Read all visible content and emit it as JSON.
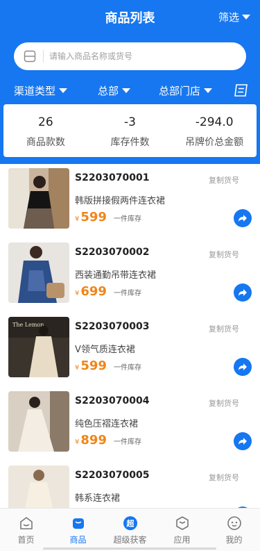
{
  "header": {
    "title": "商品列表",
    "filter_label": "筛选"
  },
  "search": {
    "placeholder": "请输入商品名称或货号"
  },
  "dropdowns": [
    {
      "label": "渠道类型"
    },
    {
      "label": "总部"
    },
    {
      "label": "总部门店"
    }
  ],
  "stats": [
    {
      "value": "26",
      "label": "商品款数"
    },
    {
      "value": "-3",
      "label": "库存件数"
    },
    {
      "value": "-294.0",
      "label": "吊牌价总金额"
    }
  ],
  "products": [
    {
      "code": "S2203070001",
      "name": "韩版拼接假两件连衣裙",
      "currency": "¥",
      "price": "599",
      "stock": "一件库存",
      "copy": "复制货号"
    },
    {
      "code": "S2203070002",
      "name": "西装通勤吊带连衣裙",
      "currency": "¥",
      "price": "699",
      "stock": "一件库存",
      "copy": "复制货号"
    },
    {
      "code": "S2203070003",
      "name": "V领气质连衣裙",
      "currency": "¥",
      "price": "599",
      "stock": "一件库存",
      "copy": "复制货号"
    },
    {
      "code": "S2203070004",
      "name": "纯色压褶连衣裙",
      "currency": "¥",
      "price": "899",
      "stock": "一件库存",
      "copy": "复制货号"
    },
    {
      "code": "S2203070005",
      "name": "韩系连衣裙",
      "currency": "¥",
      "price": "",
      "stock": "",
      "copy": "复制货号"
    }
  ],
  "thumb_labels": {
    "item3": "The Lemon"
  },
  "tabbar": [
    {
      "label": "首页",
      "icon": "home-icon"
    },
    {
      "label": "商品",
      "icon": "goods-icon"
    },
    {
      "label": "超级获客",
      "icon": "super-icon",
      "glyph": "超"
    },
    {
      "label": "应用",
      "icon": "apps-icon"
    },
    {
      "label": "我的",
      "icon": "profile-icon"
    }
  ],
  "colors": {
    "primary": "#1677f0",
    "price": "#f08519"
  }
}
